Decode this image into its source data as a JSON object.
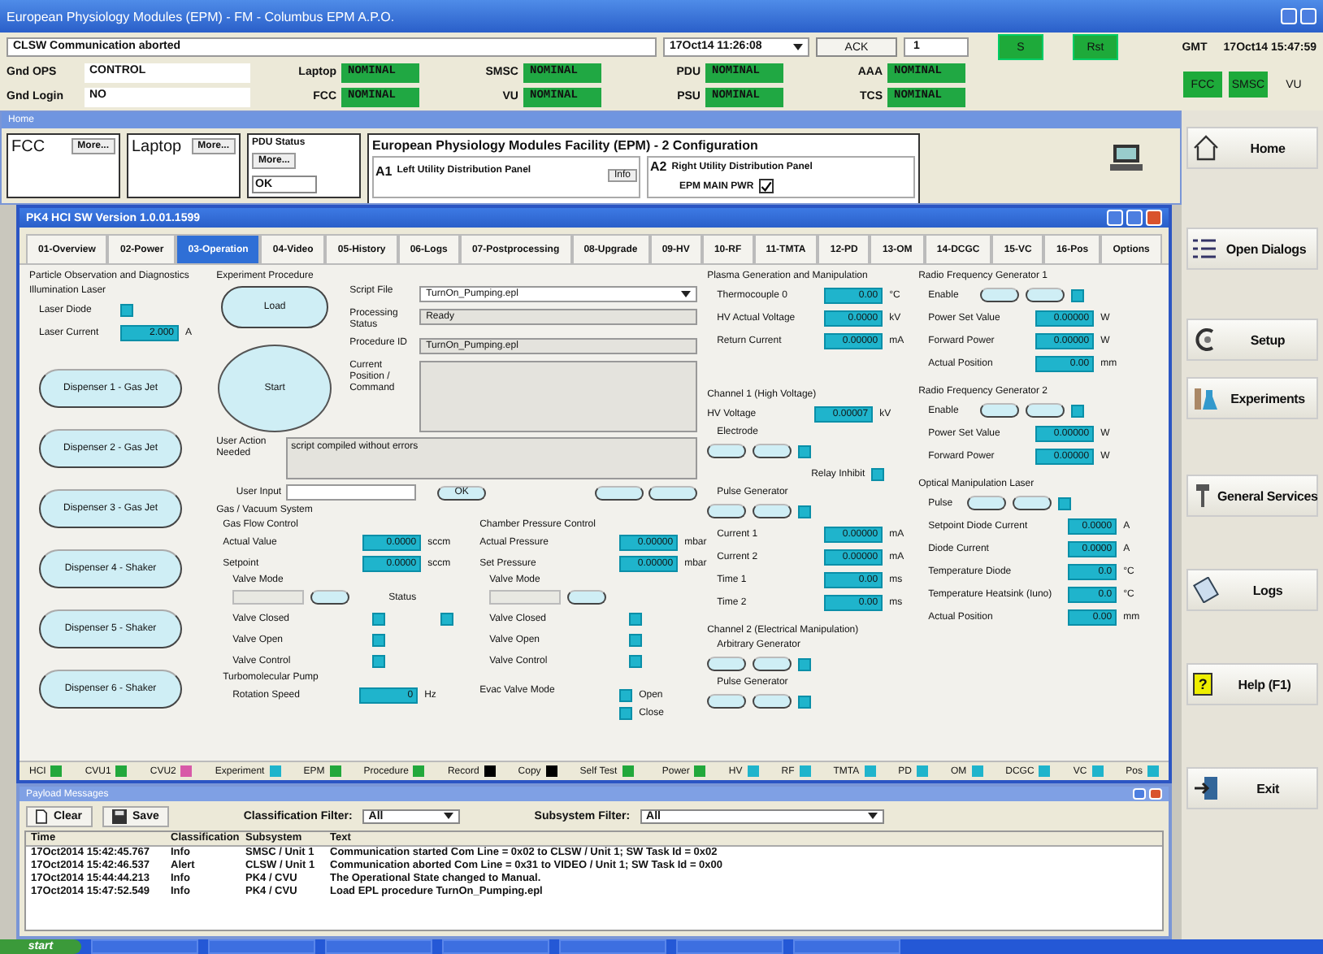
{
  "window": {
    "title": "European Physiology Modules (EPM) - FM - Columbus EPM A.P.O."
  },
  "status": {
    "message": "CLSW Communication aborted",
    "event_time": "17Oct14 11:26:08",
    "ack": "ACK",
    "count": "1",
    "buttons": [
      "S",
      "Rst"
    ],
    "gmt_label": "GMT",
    "gmt": "17Oct14 15:47:59",
    "fields": [
      {
        "label": "Gnd OPS",
        "value": "CONTROL"
      },
      {
        "label": "Gnd Login",
        "value": "NO"
      }
    ],
    "units": [
      {
        "label": "Laptop",
        "value": "NOMINAL"
      },
      {
        "label": "FCC",
        "value": "NOMINAL"
      },
      {
        "label": "SMSC",
        "value": "NOMINAL"
      },
      {
        "label": "VU",
        "value": "NOMINAL"
      },
      {
        "label": "PDU",
        "value": "NOMINAL"
      },
      {
        "label": "PSU",
        "value": "NOMINAL"
      },
      {
        "label": "AAA",
        "value": "NOMINAL"
      },
      {
        "label": "TCS",
        "value": "NOMINAL"
      }
    ],
    "links": [
      {
        "label": "FCC",
        "on": true
      },
      {
        "label": "SMSC",
        "on": true
      },
      {
        "label": "VU",
        "on": false
      }
    ]
  },
  "home": {
    "title": "Home",
    "panels": [
      {
        "label": "FCC",
        "button": "More..."
      },
      {
        "label": "Laptop",
        "button": "More..."
      },
      {
        "label": "PDU Status",
        "value": "OK",
        "button": "More..."
      }
    ],
    "epm_title": "European Physiology Modules Facility (EPM) - 2 Configuration",
    "a1": {
      "code": "A1",
      "label": "Left Utility Distribution Panel",
      "button": "Info"
    },
    "a2": {
      "code": "A2",
      "label": "Right Utility Distribution Panel",
      "power": "EPM MAIN PWR",
      "checked": true
    }
  },
  "pk4": {
    "title": "PK4 HCI SW Version 1.0.01.1599",
    "tabs": [
      {
        "label": "01-Overview",
        "selected": false
      },
      {
        "label": "02-Power",
        "selected": false
      },
      {
        "label": "03-Operation",
        "selected": true
      },
      {
        "label": "04-Video",
        "selected": false
      },
      {
        "label": "05-History",
        "selected": false
      },
      {
        "label": "06-Logs",
        "selected": false
      },
      {
        "label": "07-Postprocessing",
        "selected": false
      },
      {
        "label": "08-Upgrade",
        "selected": false
      },
      {
        "label": "09-HV",
        "selected": false
      },
      {
        "label": "10-RF",
        "selected": false
      },
      {
        "label": "11-TMTA",
        "selected": false
      },
      {
        "label": "12-PD",
        "selected": false
      },
      {
        "label": "13-OM",
        "selected": false
      },
      {
        "label": "14-DCGC",
        "selected": false
      },
      {
        "label": "15-VC",
        "selected": false
      },
      {
        "label": "16-Pos",
        "selected": false
      },
      {
        "label": "Options",
        "selected": false
      }
    ],
    "particle": {
      "title": "Particle Observation and Diagnostics",
      "subtitle": "Illumination Laser",
      "diode": {
        "label": "Laser Diode",
        "on": true
      },
      "current": {
        "label": "Laser Current",
        "value": "2.000",
        "unit": "A"
      },
      "dispensers": [
        "Dispenser 1 - Gas Jet",
        "Dispenser 2 - Gas Jet",
        "Dispenser 3 - Gas Jet",
        "Dispenser 4 - Shaker",
        "Dispenser 5 - Shaker",
        "Dispenser 6 - Shaker"
      ]
    },
    "procedure": {
      "title": "Experiment Procedure",
      "load": "Load",
      "start": "Start",
      "fields": [
        {
          "label": "Script File",
          "value": "TurnOn_Pumping.epl",
          "kind": "select"
        },
        {
          "label": "Processing Status",
          "value": "Ready",
          "kind": "text"
        },
        {
          "label": "Procedure ID",
          "value": "TurnOn_Pumping.epl",
          "kind": "text"
        },
        {
          "label": "Current Position / Command",
          "kind": "area"
        }
      ],
      "action_label": "User Action Needed",
      "action": "script compiled without errors",
      "input_label": "User Input",
      "ok": "OK"
    },
    "gas": {
      "title": "Gas / Vacuum System",
      "flow": {
        "title": "Gas Flow Control",
        "fields": [
          {
            "label": "Actual Value",
            "value": "0.0000",
            "unit": "sccm"
          },
          {
            "label": "Setpoint",
            "value": "0.0000",
            "unit": "sccm"
          }
        ],
        "valve_mode": "Valve Mode",
        "status": {
          "label": "Status",
          "on": true
        },
        "leds": [
          {
            "label": "Valve Closed",
            "on": true
          },
          {
            "label": "Valve Open",
            "on": true
          },
          {
            "label": "Valve Control",
            "on": true
          }
        ]
      },
      "chamber": {
        "title": "Chamber Pressure Control",
        "fields": [
          {
            "label": "Actual Pressure",
            "value": "0.00000",
            "unit": "mbar"
          },
          {
            "label": "Set Pressure",
            "value": "0.00000",
            "unit": "mbar"
          }
        ],
        "valve_mode": "Valve Mode",
        "leds": [
          {
            "label": "Valve Closed",
            "on": true
          },
          {
            "label": "Valve Open",
            "on": true
          },
          {
            "label": "Valve Control",
            "on": true
          }
        ]
      },
      "pump": {
        "title": "Turbomolecular Pump",
        "field": {
          "label": "Rotation Speed",
          "value": "0",
          "unit": "Hz"
        }
      },
      "evac": {
        "label": "Evac Valve Mode",
        "options": [
          {
            "label": "Open",
            "on": true
          },
          {
            "label": "Close",
            "on": true
          }
        ]
      }
    },
    "plasma": {
      "title": "Plasma Generation and Manipulation",
      "fields": [
        {
          "label": "Thermocouple 0",
          "value": "0.00",
          "unit": "°C"
        },
        {
          "label": "HV Actual Voltage",
          "value": "0.0000",
          "unit": "kV"
        },
        {
          "label": "Return Current",
          "value": "0.00000",
          "unit": "mA"
        }
      ],
      "ch1": {
        "title": "Channel 1 (High Voltage)",
        "field": {
          "label": "HV Voltage",
          "value": "0.00007",
          "unit": "kV"
        },
        "electrode": "Electrode",
        "relay": "Relay Inhibit",
        "pulse": "Pulse Generator",
        "fields": [
          {
            "label": "Current 1",
            "value": "0.00000",
            "unit": "mA"
          },
          {
            "label": "Current 2",
            "value": "0.00000",
            "unit": "mA"
          },
          {
            "label": "Time 1",
            "value": "0.00",
            "unit": "ms"
          },
          {
            "label": "Time 2",
            "value": "0.00",
            "unit": "ms"
          }
        ]
      },
      "ch2": {
        "title": "Channel 2 (Electrical Manipulation)",
        "arb": "Arbitrary Generator",
        "pulse": "Pulse Generator"
      }
    },
    "rf": [
      {
        "title": "Radio Frequency Generator 1",
        "enable": "Enable",
        "on": true,
        "fields": [
          {
            "label": "Power Set Value",
            "value": "0.00000",
            "unit": "W"
          },
          {
            "label": "Forward Power",
            "value": "0.00000",
            "unit": "W"
          },
          {
            "label": "Actual Position",
            "value": "0.00",
            "unit": "mm"
          }
        ]
      },
      {
        "title": "Radio Frequency Generator 2",
        "enable": "Enable",
        "on": true,
        "fields": [
          {
            "label": "Power Set Value",
            "value": "0.00000",
            "unit": "W"
          },
          {
            "label": "Forward Power",
            "value": "0.00000",
            "unit": "W"
          }
        ]
      }
    ],
    "laser": {
      "title": "Optical Manipulation Laser",
      "pulse": "Pulse",
      "on": true,
      "fields": [
        {
          "label": "Setpoint Diode Current",
          "value": "0.0000",
          "unit": "A"
        },
        {
          "label": "Diode Current",
          "value": "0.0000",
          "unit": "A"
        },
        {
          "label": "Temperature Diode",
          "value": "0.0",
          "unit": "°C"
        },
        {
          "label": "Temperature Heatsink (Iuno)",
          "value": "0.0",
          "unit": "°C"
        },
        {
          "label": "Actual Position",
          "value": "0.00",
          "unit": "mm"
        }
      ]
    },
    "leds": [
      {
        "label": "HCI",
        "color": "#22a83c"
      },
      {
        "label": "CVU1",
        "color": "#22a83c"
      },
      {
        "label": "CVU2",
        "color": "#d85aa8"
      },
      {
        "label": "Experiment",
        "color": "#1fb4cc"
      },
      {
        "label": "EPM",
        "color": "#22a83c"
      },
      {
        "label": "Procedure",
        "color": "#22a83c"
      },
      {
        "label": "Record",
        "color": "#000000"
      },
      {
        "label": "Copy",
        "color": "#000000"
      },
      {
        "label": "Self Test",
        "color": "#22a83c"
      }
    ],
    "leds_right": [
      {
        "label": "Power",
        "color": "#22a83c"
      },
      {
        "label": "HV",
        "color": "#1fb4cc"
      },
      {
        "label": "RF",
        "color": "#1fb4cc"
      },
      {
        "label": "TMTA",
        "color": "#1fb4cc"
      },
      {
        "label": "PD",
        "color": "#1fb4cc"
      },
      {
        "label": "OM",
        "color": "#1fb4cc"
      },
      {
        "label": "DCGC",
        "color": "#1fb4cc"
      },
      {
        "label": "VC",
        "color": "#1fb4cc"
      },
      {
        "label": "Pos",
        "color": "#1fb4cc"
      }
    ]
  },
  "messages": {
    "title": "Payload Messages",
    "clear": "Clear",
    "save": "Save",
    "class_label": "Classification Filter:",
    "class_value": "All",
    "sub_label": "Subsystem Filter:",
    "sub_value": "All",
    "columns": [
      "Time",
      "Classification",
      "Subsystem",
      "Text"
    ],
    "rows": [
      [
        "17Oct2014 15:42:45.767",
        "Info",
        "SMSC / Unit 1",
        "Communication started Com Line = 0x02 to CLSW / Unit 1; SW Task Id = 0x02"
      ],
      [
        "17Oct2014 15:42:46.537",
        "Alert",
        "CLSW / Unit 1",
        "Communication aborted Com Line = 0x31 to VIDEO / Unit 1; SW Task Id = 0x00"
      ],
      [
        "17Oct2014 15:44:44.213",
        "Info",
        "PK4 / CVU",
        "The Operational State changed to Manual."
      ],
      [
        "17Oct2014 15:47:52.549",
        "Info",
        "PK4 / CVU",
        "Load EPL procedure TurnOn_Pumping.epl"
      ]
    ]
  },
  "sidebar": [
    {
      "label": "Home",
      "kind": "home"
    },
    {
      "label": "Open Dialogs",
      "kind": "dialogs"
    },
    {
      "label": "Setup",
      "kind": "setup"
    },
    {
      "label": "Experiments",
      "kind": "experiments"
    },
    {
      "label": "General Services",
      "kind": "services"
    },
    {
      "label": "Logs",
      "kind": "logs"
    },
    {
      "label": "Help (F1)",
      "kind": "help",
      "icon_text": "?"
    },
    {
      "label": "Exit",
      "kind": "exit"
    }
  ],
  "taskbar": {
    "start": "start"
  }
}
